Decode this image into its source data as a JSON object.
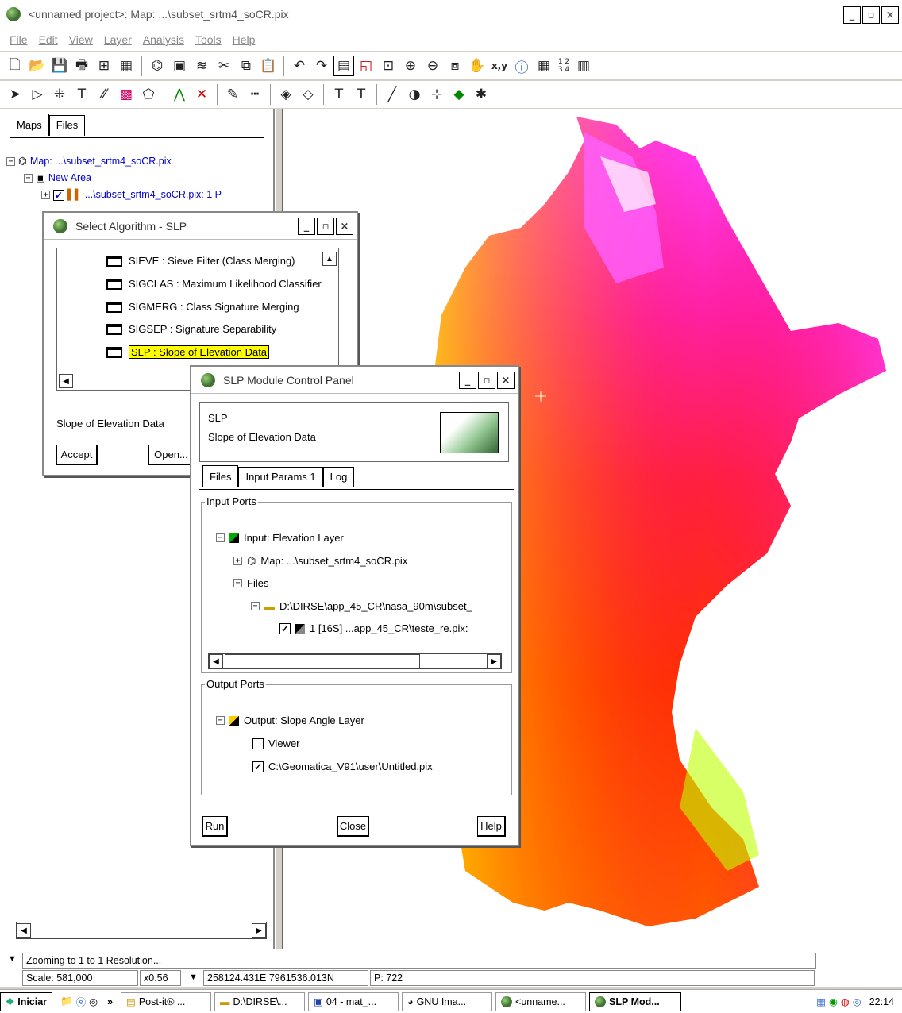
{
  "window": {
    "title": "<unnamed project>: Map: ...\\subset_srtm4_soCR.pix",
    "min": "_",
    "max": "▫",
    "close": "×"
  },
  "menu": [
    "File",
    "Edit",
    "View",
    "Layer",
    "Analysis",
    "Tools",
    "Help"
  ],
  "left_panel": {
    "tabs": [
      "Maps",
      "Files"
    ],
    "tree": {
      "map": "Map: ...\\subset_srtm4_soCR.pix",
      "area": "New Area",
      "layer": "...\\subset_srtm4_soCR.pix: 1 P"
    }
  },
  "algo_dialog": {
    "title": "Select Algorithm - SLP",
    "items": [
      "SIEVE : Sieve Filter (Class Merging)",
      "SIGCLAS : Maximum Likelihood Classifier",
      "SIGMERG : Class Signature Merging",
      "SIGSEP : Signature Separability",
      "SLP : Slope of Elevation Data"
    ],
    "description": "Slope of Elevation Data",
    "accept": "Accept",
    "open": "Open..."
  },
  "slp_panel": {
    "title": "SLP Module Control Panel",
    "module_name": "SLP",
    "module_desc": "Slope of Elevation Data",
    "tabs": [
      "Files",
      "Input Params 1",
      "Log"
    ],
    "input_ports": {
      "label": "Input Ports",
      "node": "Input: Elevation Layer",
      "map": "Map: ...\\subset_srtm4_soCR.pix",
      "files": "Files",
      "folder": "D:\\DIRSE\\app_45_CR\\nasa_90m\\subset_",
      "file": "1 [16S] ...app_45_CR\\teste_re.pix:"
    },
    "output_ports": {
      "label": "Output Ports",
      "node": "Output: Slope Angle Layer",
      "viewer": "Viewer",
      "file": "C:\\Geomatica_V91\\user\\Untitled.pix"
    },
    "run": "Run",
    "close": "Close",
    "help": "Help"
  },
  "status": {
    "message": "Zooming to 1 to 1 Resolution...",
    "scale": "Scale: 581,000",
    "zoom": "x0.56",
    "coords": "258124.431E 7961536.013N",
    "pixel": "P: 722"
  },
  "taskbar": {
    "start": "Iniciar",
    "chevron": "»",
    "tasks": [
      "Post-it® ...",
      "D:\\DIRSE\\...",
      "04 - mat_...",
      "GNU Ima...",
      "<unname...",
      "SLP Mod..."
    ],
    "clock": "22:14"
  },
  "toolbar_text": {
    "xy": "x,y",
    "nums": "1 2 3 4"
  },
  "colors": {
    "highlight": "#ffff00",
    "link": "#0000cc"
  }
}
